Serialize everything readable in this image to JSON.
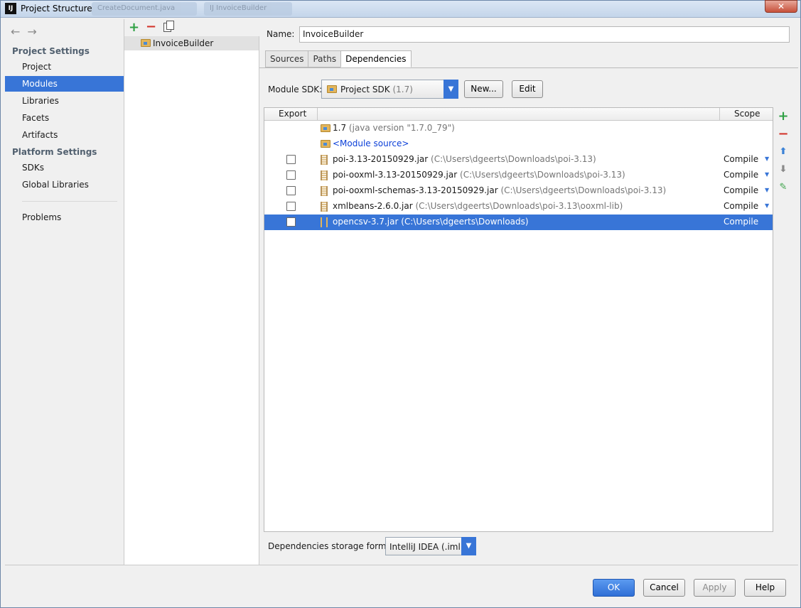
{
  "window": {
    "title": "Project Structure",
    "app_icon": "IJ",
    "taskbar_tabs": [
      "CreateDocument.java",
      "IJ InvoiceBuilder"
    ],
    "close_label": "✕"
  },
  "nav": {
    "back_icon": "←",
    "forward_icon": "→",
    "project_settings_header": "Project Settings",
    "project_settings_items": [
      "Project",
      "Modules",
      "Libraries",
      "Facets",
      "Artifacts"
    ],
    "selected_item": "Modules",
    "platform_settings_header": "Platform Settings",
    "platform_settings_items": [
      "SDKs",
      "Global Libraries"
    ],
    "problems_label": "Problems"
  },
  "modules": {
    "add_icon": "+",
    "remove_icon": "−",
    "items": [
      "InvoiceBuilder"
    ]
  },
  "detail": {
    "name_label": "Name:",
    "name_value": "InvoiceBuilder",
    "tabs": [
      "Sources",
      "Paths",
      "Dependencies"
    ],
    "active_tab": "Dependencies",
    "module_sdk_label": "Module SDK:",
    "sdk_selected": "Project SDK",
    "sdk_version": "(1.7)",
    "new_button": "New...",
    "edit_button": "Edit",
    "table": {
      "col_export": "Export",
      "col_scope": "Scope",
      "rows": [
        {
          "type": "sdk",
          "name": "1.7",
          "path": "(java version \"1.7.0_79\")",
          "scope": "",
          "checkbox": false
        },
        {
          "type": "module-source",
          "name": "<Module source>",
          "path": "",
          "scope": "",
          "checkbox": false
        },
        {
          "type": "jar",
          "name": "poi-3.13-20150929.jar",
          "path": "(C:\\Users\\dgeerts\\Downloads\\poi-3.13)",
          "scope": "Compile",
          "checkbox": true
        },
        {
          "type": "jar",
          "name": "poi-ooxml-3.13-20150929.jar",
          "path": "(C:\\Users\\dgeerts\\Downloads\\poi-3.13)",
          "scope": "Compile",
          "checkbox": true
        },
        {
          "type": "jar",
          "name": "poi-ooxml-schemas-3.13-20150929.jar",
          "path": "(C:\\Users\\dgeerts\\Downloads\\poi-3.13)",
          "scope": "Compile",
          "checkbox": true
        },
        {
          "type": "jar",
          "name": "xmlbeans-2.6.0.jar",
          "path": "(C:\\Users\\dgeerts\\Downloads\\poi-3.13\\ooxml-lib)",
          "scope": "Compile",
          "checkbox": true
        },
        {
          "type": "jar",
          "name": "opencsv-3.7.jar",
          "path": "(C:\\Users\\dgeerts\\Downloads)",
          "scope": "Compile",
          "checkbox": true,
          "selected": true
        }
      ]
    },
    "side_tools": {
      "add": "+",
      "remove": "−",
      "up": "⬆",
      "down": "⬇",
      "edit": "✎"
    },
    "storage_format_label": "Dependencies storage format:",
    "storage_format_value": "IntelliJ IDEA (.iml)"
  },
  "buttons": {
    "ok": "OK",
    "cancel": "Cancel",
    "apply": "Apply",
    "help": "Help"
  },
  "colors": {
    "selection": "#3875d7",
    "add": "#2ea043",
    "remove": "#d2342b"
  }
}
